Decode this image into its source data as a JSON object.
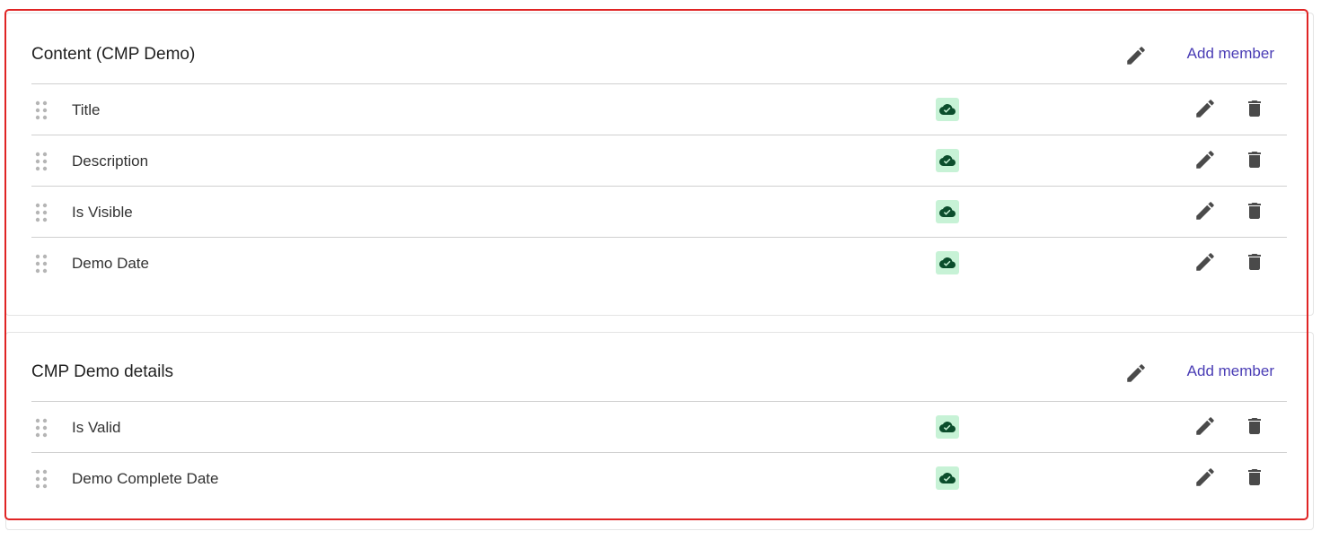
{
  "sections": [
    {
      "title": "Content (CMP Demo)",
      "add_member_label": "Add member",
      "rows": [
        {
          "label": "Title"
        },
        {
          "label": "Description"
        },
        {
          "label": "Is Visible"
        },
        {
          "label": "Demo Date"
        }
      ]
    },
    {
      "title": "CMP Demo details",
      "add_member_label": "Add member",
      "rows": [
        {
          "label": "Is Valid"
        },
        {
          "label": "Demo Complete Date"
        }
      ]
    }
  ],
  "icons": {
    "drag": "drag-handle-icon",
    "status": "cloud-check-icon",
    "edit": "pencil-icon",
    "delete": "trash-icon"
  },
  "colors": {
    "accent": "#4a3db5",
    "status_bg": "#c7f2d6",
    "status_fg": "#0b4d2c",
    "icon": "#4a4a4a",
    "highlight": "#e02424"
  }
}
